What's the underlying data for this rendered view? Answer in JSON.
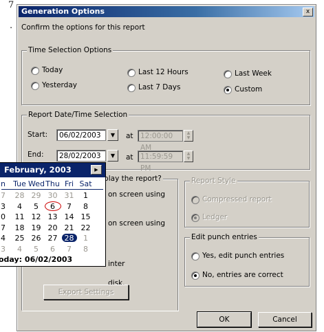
{
  "page_fragment": {
    "text_top": "7",
    "text_second": "."
  },
  "dialog": {
    "title": "Generation Options",
    "close_glyph": "x",
    "subtitle": "Confirm the options for this report",
    "time_selection": {
      "legend": "Time Selection Options",
      "options": [
        {
          "label": "Today",
          "checked": false
        },
        {
          "label": "Last 12 Hours",
          "checked": false
        },
        {
          "label": "Last Week",
          "checked": false
        },
        {
          "label": "Yesterday",
          "checked": false
        },
        {
          "label": "Last 7 Days",
          "checked": false
        },
        {
          "label": "Custom",
          "checked": true
        }
      ]
    },
    "date_time": {
      "legend": "Report Date/Time Selection",
      "start_label": "Start:",
      "start_date": "06/02/2003",
      "end_label": "End:",
      "end_date": "28/02/2003",
      "at_label": "at",
      "start_time": "12:00:00 AM",
      "end_time": "11:59:59 PM"
    },
    "display": {
      "legend_visible": "display the report?",
      "opt1": "on screen using",
      "opt2": "on screen using",
      "opt3": "inter",
      "opt4": "disk.",
      "export_button": "Export Settings"
    },
    "report_style": {
      "legend": "Report Style",
      "compressed": "Compressed report",
      "ledger": "Ledger"
    },
    "edit_punch": {
      "legend": "Edit punch entries",
      "yes": "Yes, edit punch entries",
      "no": "No, entries are correct"
    },
    "ok_button": "OK",
    "cancel_button": "Cancel"
  },
  "calendar": {
    "month": "February, 2003",
    "next_glyph": "▶",
    "weekdays": [
      "n",
      "Tue",
      "Wed",
      "Thu",
      "Fri",
      "Sat"
    ],
    "weeks": [
      [
        "7",
        "28",
        "29",
        "30",
        "31",
        "1"
      ],
      [
        "3",
        "4",
        "5",
        "6",
        "7",
        "8"
      ],
      [
        "0",
        "11",
        "12",
        "13",
        "14",
        "15"
      ],
      [
        "7",
        "18",
        "19",
        "20",
        "21",
        "22"
      ],
      [
        "4",
        "25",
        "26",
        "27",
        "28",
        "1"
      ],
      [
        "3",
        "4",
        "5",
        "6",
        "7",
        "8"
      ]
    ],
    "other_month": [
      [
        true,
        true,
        true,
        true,
        true,
        false
      ],
      [
        false,
        false,
        false,
        false,
        false,
        false
      ],
      [
        false,
        false,
        false,
        false,
        false,
        false
      ],
      [
        false,
        false,
        false,
        false,
        false,
        false
      ],
      [
        false,
        false,
        false,
        false,
        false,
        true
      ],
      [
        true,
        true,
        true,
        true,
        true,
        true
      ]
    ],
    "today_label": "oday: 06/02/2003"
  }
}
